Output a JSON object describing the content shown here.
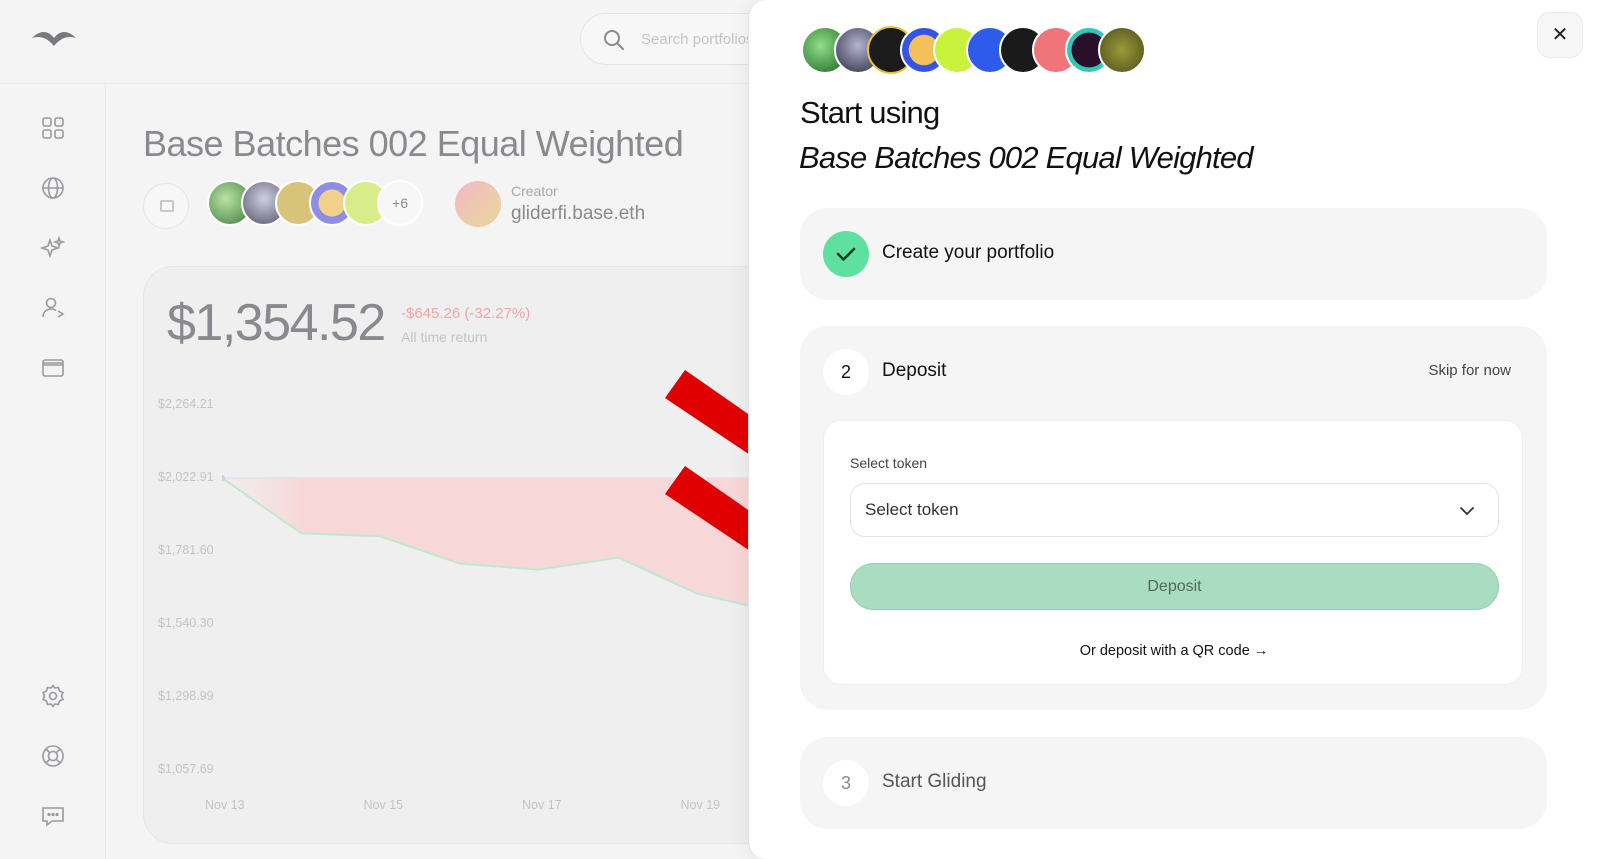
{
  "app": {
    "search_placeholder": "Search portfolios"
  },
  "sidebar": {
    "items": [
      {
        "icon": "dashboard-icon"
      },
      {
        "icon": "globe-icon"
      },
      {
        "icon": "sparkles-icon"
      },
      {
        "icon": "user-switch-icon"
      },
      {
        "icon": "wallet-icon"
      },
      {
        "icon": "gear-icon"
      },
      {
        "icon": "lifebuoy-icon"
      },
      {
        "icon": "chat-icon"
      }
    ]
  },
  "portfolio": {
    "title": "Base Batches 002 Equal Weighted",
    "more_tokens": "+6",
    "creator_label": "Creator",
    "creator_name": "gliderfi.base.eth",
    "value": "$1,354.52",
    "change": "-$645.26 (-32.27%)",
    "change_label": "All time return"
  },
  "chart_data": {
    "type": "area",
    "yticks": [
      "$2,264.21",
      "$2,022.91",
      "$1,781.60",
      "$1,540.30",
      "$1,298.99",
      "$1,057.69"
    ],
    "xticks": [
      "Nov 13",
      "Nov 15",
      "Nov 17",
      "Nov 19"
    ],
    "baseline": 2022.91,
    "x": [
      "Nov 13",
      "Nov 14",
      "Nov 15",
      "Nov 16",
      "Nov 17",
      "Nov 18",
      "Nov 19",
      "Nov 20"
    ],
    "values": [
      2022.91,
      1840,
      1830,
      1740,
      1720,
      1760,
      1640,
      1580
    ],
    "colors": {
      "line": "#bfe9cf",
      "fill": "#f7d7d7"
    }
  },
  "modal": {
    "heading_line1": "Start using",
    "heading_line2": "Base Batches 002 Equal Weighted",
    "close_label": "✕",
    "steps": [
      {
        "number": "✓",
        "title": "Create your portfolio",
        "status": "done"
      },
      {
        "number": "2",
        "title": "Deposit",
        "status": "active",
        "skip_label": "Skip for now"
      },
      {
        "number": "3",
        "title": "Start Gliding",
        "status": "pending"
      }
    ],
    "deposit": {
      "field_label": "Select token",
      "select_value": "Select token",
      "button_label": "Deposit",
      "qr_link": "Or deposit with a QR code →"
    }
  },
  "colors": {
    "accent_green": "#5fe0a1",
    "deposit_button": "#a9dcc0",
    "annotation_arrow": "#e00000"
  }
}
